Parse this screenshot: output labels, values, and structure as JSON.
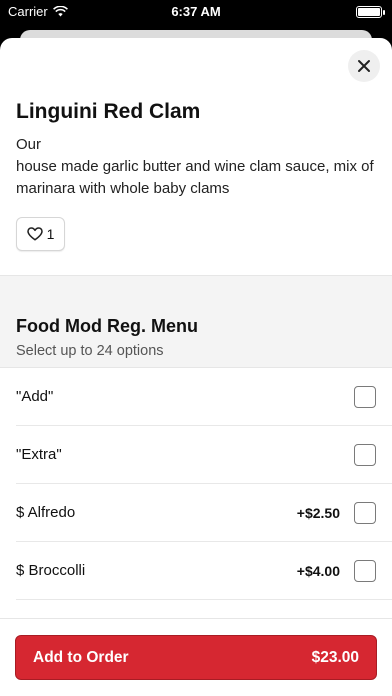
{
  "status_bar": {
    "carrier": "Carrier",
    "time": "6:37 AM",
    "battery_level": 1.0
  },
  "item": {
    "title": "Linguini Red Clam",
    "description": "Our\nhouse made garlic butter and wine clam sauce, mix of marinara with whole baby clams",
    "like_count": "1"
  },
  "modifier_group": {
    "title": "Food Mod Reg. Menu",
    "subtitle": "Select up to 24 options",
    "options": [
      {
        "label": "\"Add\"",
        "price": ""
      },
      {
        "label": "\"Extra\"",
        "price": ""
      },
      {
        "label": "$ Alfredo",
        "price": "+$2.50"
      },
      {
        "label": "$ Broccolli",
        "price": "+$4.00"
      },
      {
        "label": "",
        "price": ""
      }
    ]
  },
  "footer": {
    "add_label": "Add to Order",
    "total": "$23.00"
  },
  "colors": {
    "accent": "#d62731"
  },
  "icons": {
    "close": "close-icon",
    "heart": "heart-icon",
    "wifi": "wifi-icon",
    "battery": "battery-icon"
  }
}
